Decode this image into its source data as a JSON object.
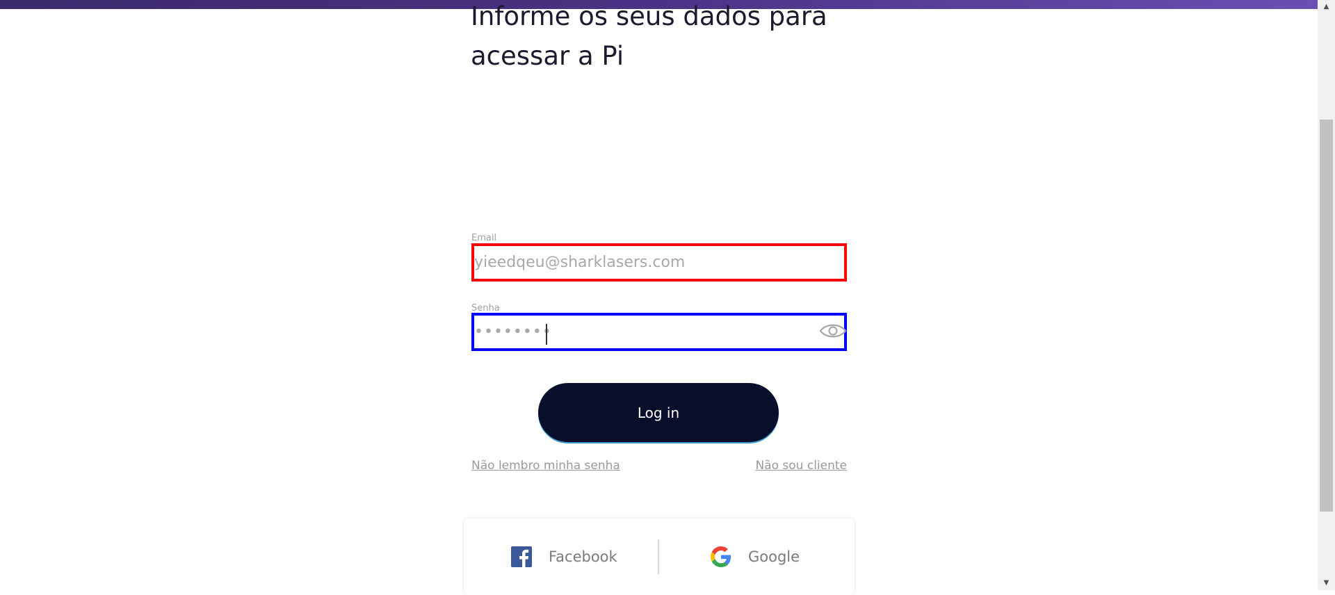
{
  "page": {
    "heading_line1": "Informe os seus dados para",
    "heading_line2": "acessar a Pi"
  },
  "form": {
    "email_label": "Email",
    "email_value": "yieedqeu@sharklasers.com",
    "password_label": "Senha",
    "password_value": "••••••••",
    "login_label": "Log in"
  },
  "links": {
    "forgot_password": "Não lembro minha senha",
    "not_client": "Não sou cliente"
  },
  "social": {
    "facebook_label": "Facebook",
    "google_label": "Google"
  },
  "colors": {
    "top_bar_start": "#3b2a6d",
    "top_bar_end": "#6b4fb3",
    "login_button": "#090e2b",
    "email_highlight": "#ff0000",
    "password_highlight": "#0000ff",
    "facebook_blue": "#3b5998"
  },
  "icons": {
    "eye": "eye-icon",
    "facebook": "facebook-icon",
    "google": "google-icon"
  }
}
